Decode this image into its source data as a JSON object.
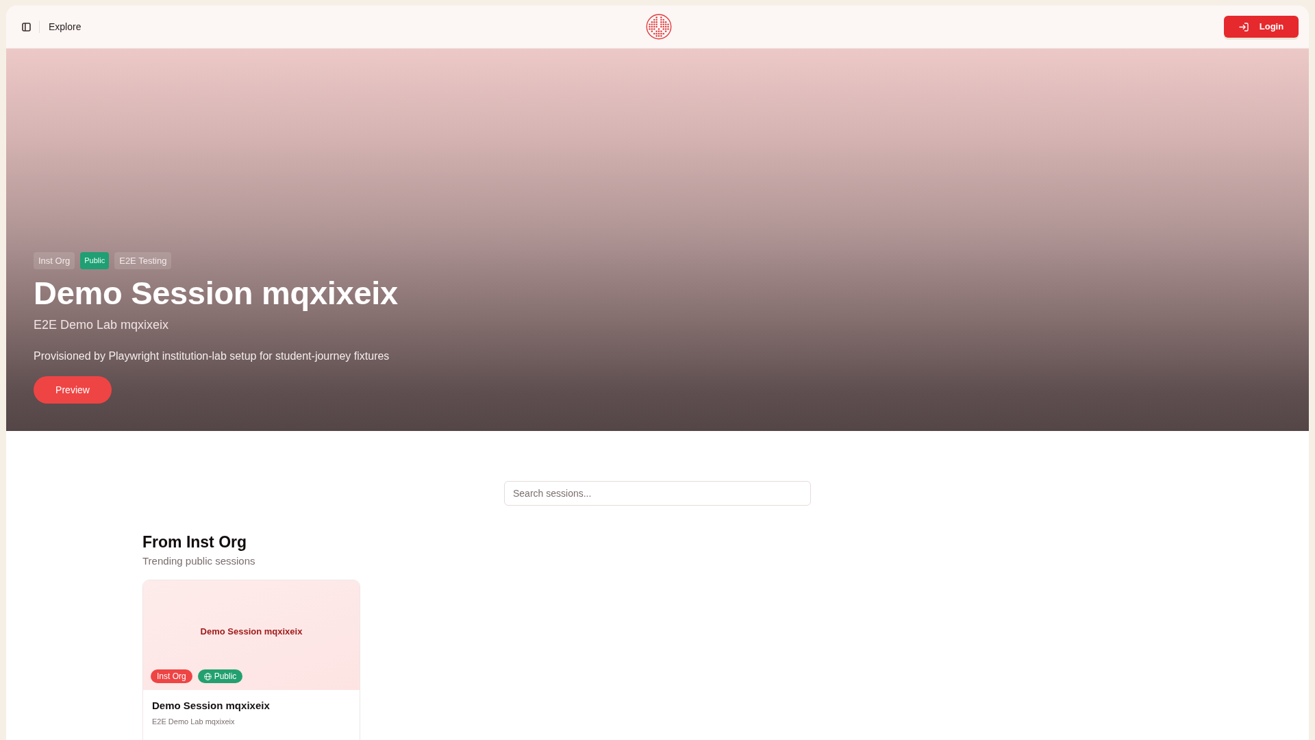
{
  "header": {
    "nav_label": "Explore",
    "login_button": "Login"
  },
  "hero": {
    "tags": [
      {
        "label": "Inst Org",
        "kind": "org"
      },
      {
        "label": "Public",
        "kind": "visibility"
      },
      {
        "label": "E2E Testing",
        "kind": "category"
      }
    ],
    "title": "Demo Session mqxixeix",
    "subtitle": "E2E Demo Lab mqxixeix",
    "description": "Provisioned by Playwright institution-lab setup for student-journey fixtures",
    "button": "Preview"
  },
  "search": {
    "placeholder": "Search sessions..."
  },
  "section": {
    "title": "From Inst Org",
    "subtitle": "Trending public sessions",
    "cards": [
      {
        "cover_title": "Demo Session mqxixeix",
        "badges": [
          {
            "label": "Inst Org",
            "kind": "org"
          },
          {
            "label": "Public",
            "kind": "visibility"
          }
        ],
        "title": "Demo Session mqxixeix",
        "subtitle": "E2E Demo Lab mqxixeix"
      }
    ]
  }
}
